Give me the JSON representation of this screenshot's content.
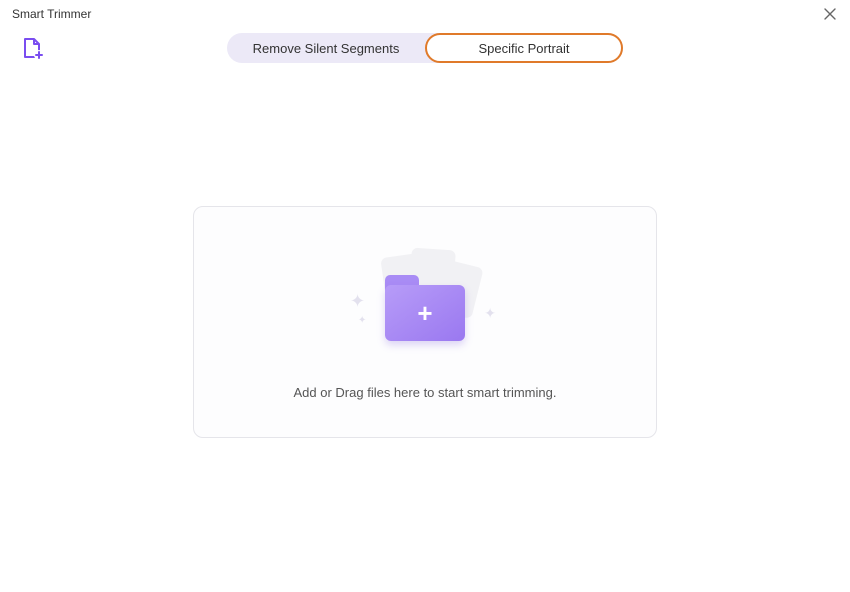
{
  "window": {
    "title": "Smart Trimmer"
  },
  "tabs": {
    "remove_silent": "Remove Silent Segments",
    "specific_portrait": "Specific Portrait"
  },
  "dropzone": {
    "prompt": "Add or Drag files here to start smart trimming."
  },
  "icons": {
    "close": "close-icon",
    "add_file": "add-file-icon",
    "folder_plus": "folder-plus-icon"
  }
}
